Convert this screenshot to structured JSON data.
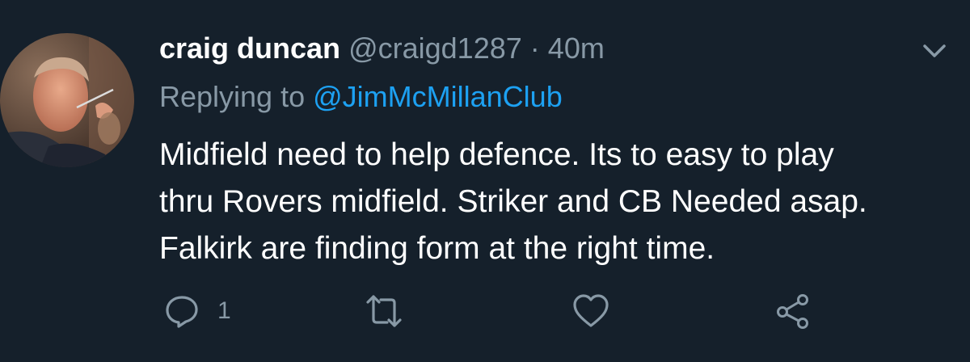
{
  "tweet": {
    "display_name": "craig duncan",
    "handle": "@craigd1287",
    "separator": "·",
    "time": "40m",
    "replying_prefix": "Replying to",
    "replying_to": "@JimMcMillanClub",
    "body_lines": [
      "Midfield need to help defence. Its to easy to play",
      "thru Rovers midfield. Striker and CB Needed asap.",
      "Falkirk are finding form at the right time."
    ],
    "reply_count": "1"
  },
  "icons": {
    "menu": "chevron-down-icon",
    "reply": "comment-icon",
    "retweet": "retweet-icon",
    "like": "heart-icon",
    "share": "share-icon"
  },
  "colors": {
    "background": "#15202b",
    "text": "#ffffff",
    "secondary_text": "#8899a6",
    "link": "#1da1f2"
  }
}
